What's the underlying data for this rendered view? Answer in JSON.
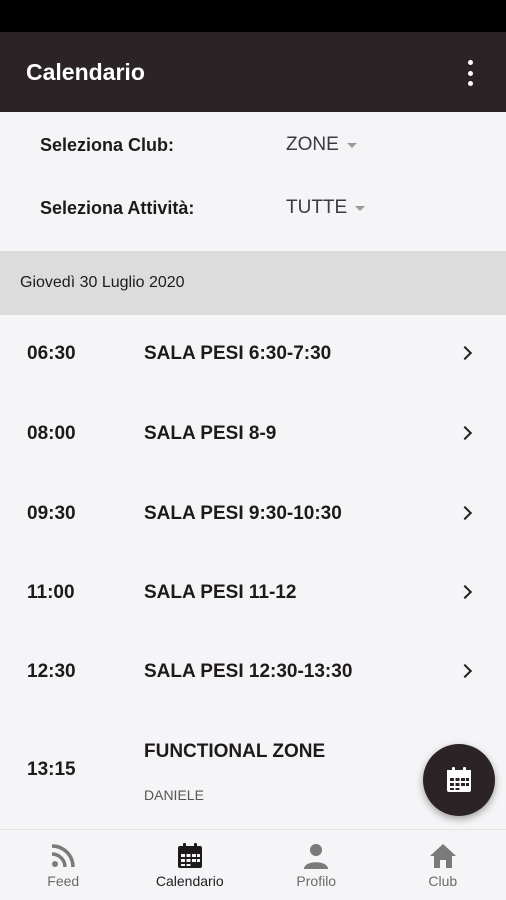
{
  "appbar": {
    "title": "Calendario",
    "menu_icon": "more-vert-icon"
  },
  "filters": {
    "club": {
      "label": "Seleziona Club:",
      "value": "ZONE"
    },
    "activity": {
      "label": "Seleziona Attività:",
      "value": "TUTTE"
    }
  },
  "date_header": "Giovedì 30 Luglio 2020",
  "events": [
    {
      "time": "06:30",
      "title": "SALA PESI 6:30-7:30",
      "subtitle": ""
    },
    {
      "time": "08:00",
      "title": "SALA PESI 8-9",
      "subtitle": ""
    },
    {
      "time": "09:30",
      "title": "SALA PESI 9:30-10:30",
      "subtitle": ""
    },
    {
      "time": "11:00",
      "title": "SALA PESI 11-12",
      "subtitle": ""
    },
    {
      "time": "12:30",
      "title": "SALA PESI 12:30-13:30",
      "subtitle": ""
    },
    {
      "time": "13:15",
      "title": "FUNCTIONAL ZONE",
      "subtitle": "DANIELE"
    }
  ],
  "fab": {
    "icon": "calendar-icon"
  },
  "bottom_nav": [
    {
      "label": "Feed",
      "icon": "rss-feed-icon",
      "active": false
    },
    {
      "label": "Calendario",
      "icon": "calendar-icon",
      "active": true
    },
    {
      "label": "Profilo",
      "icon": "person-icon",
      "active": false
    },
    {
      "label": "Club",
      "icon": "home-icon",
      "active": false
    }
  ],
  "colors": {
    "primary": "#2b2326",
    "background": "#f5f5f7",
    "date_header_bg": "#dcdcdc"
  }
}
